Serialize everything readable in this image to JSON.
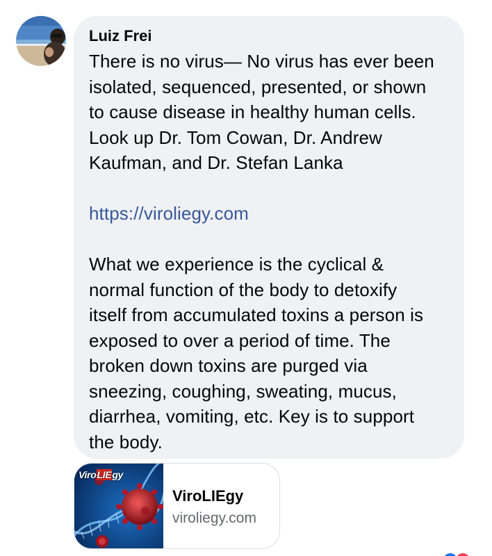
{
  "comment": {
    "author": "Luiz Frei",
    "paragraph1": "There is no virus— No virus has ever been\nisolated, sequenced, presented, or shown\nto cause disease in healthy human cells.\nLook up Dr. Tom Cowan, Dr. Andrew\nKaufman, and Dr. Stefan Lanka",
    "link": "https://viroliegy.com",
    "paragraph2": "What we experience is the cyclical &\nnormal function of the body to detoxify\nitself from accumulated toxins a person is\nexposed to over a period of time. The\nbroken down toxins are purged via\nsneezing, coughing, sweating, mucus,\ndiarrhea, vomiting, etc. Key is to support\nthe body."
  },
  "link_preview": {
    "thumbnail_logo_prefix": "Viro",
    "thumbnail_logo_highlight": "LIE",
    "thumbnail_logo_suffix": "gy",
    "title": "ViroLIEgy",
    "domain": "viroliegy.com"
  },
  "colors": {
    "bubble_bg": "#eff1f5",
    "link": "#385898",
    "secondary_text": "#65676b",
    "logo_highlight": "#d7261e"
  },
  "icons": {
    "avatar": "user-avatar-beach-photo",
    "thumbnail": "virus-dna-image"
  }
}
